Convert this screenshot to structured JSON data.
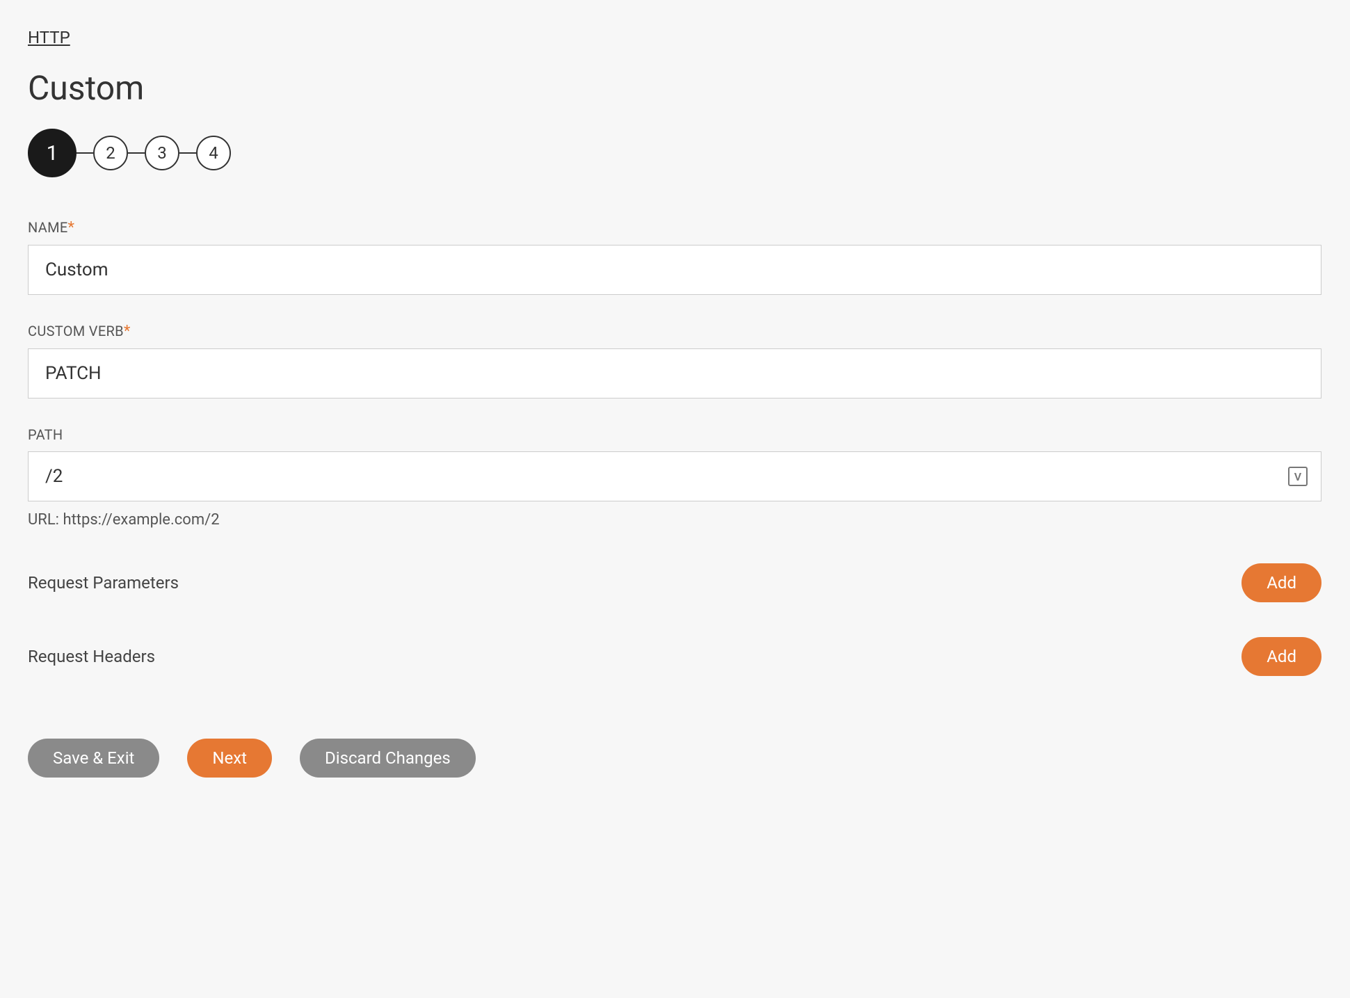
{
  "breadcrumb": "HTTP",
  "page_title": "Custom",
  "stepper": {
    "steps": [
      "1",
      "2",
      "3",
      "4"
    ],
    "active_index": 0
  },
  "fields": {
    "name": {
      "label": "NAME",
      "required_mark": "*",
      "value": "Custom"
    },
    "custom_verb": {
      "label": "CUSTOM VERB",
      "required_mark": "*",
      "value": "PATCH"
    },
    "path": {
      "label": "PATH",
      "value": "/2",
      "icon_letter": "V",
      "helper": "URL: https://example.com/2"
    }
  },
  "sections": {
    "request_parameters": {
      "label": "Request Parameters",
      "button": "Add"
    },
    "request_headers": {
      "label": "Request Headers",
      "button": "Add"
    }
  },
  "footer": {
    "save_exit": "Save & Exit",
    "next": "Next",
    "discard": "Discard Changes"
  }
}
